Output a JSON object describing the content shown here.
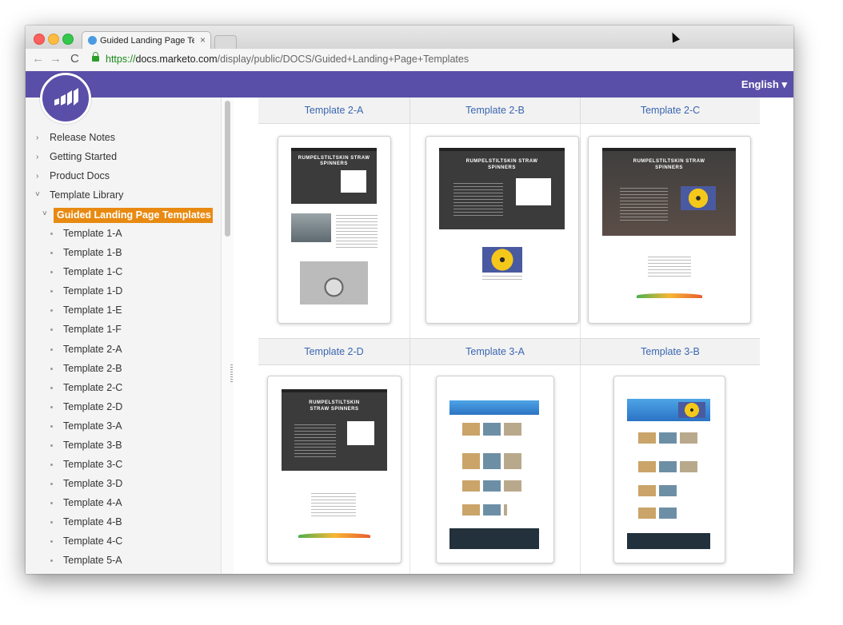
{
  "browser": {
    "tab_title": "Guided Landing Page Temp",
    "tab_close": "×",
    "url_protocol": "https://",
    "url_host": "docs.marketo.com",
    "url_path": "/display/public/DOCS/Guided+Landing+Page+Templates",
    "back_glyph": "←",
    "forward_glyph": "→",
    "reload_glyph": "C"
  },
  "header": {
    "language_label": "English ▾"
  },
  "sidebar": {
    "top_items": [
      {
        "label": "Release Notes"
      },
      {
        "label": "Getting Started"
      },
      {
        "label": "Product Docs"
      },
      {
        "label": "Template Library"
      }
    ],
    "selected_item": "Guided Landing Page Templates",
    "children": [
      "Template 1-A",
      "Template 1-B",
      "Template 1-C",
      "Template 1-D",
      "Template 1-E",
      "Template 1-F",
      "Template 2-A",
      "Template 2-B",
      "Template 2-C",
      "Template 2-D",
      "Template 3-A",
      "Template 3-B",
      "Template 3-C",
      "Template 3-D",
      "Template 4-A",
      "Template 4-B",
      "Template 4-C",
      "Template 5-A"
    ]
  },
  "templates": {
    "row1": [
      "Template 2-A",
      "Template 2-B",
      "Template 2-C"
    ],
    "row2": [
      "Template 2-D",
      "Template 3-A",
      "Template 3-B"
    ],
    "preview_headline_1": "RUMPELSTILTSKIN STRAW",
    "preview_headline_2": "SPINNERS",
    "preview_headline_alt_1": "RUMPELSTILTSKIN",
    "preview_headline_alt_2": "STRAW SPINNERS"
  },
  "colors": {
    "header_purple": "#5a4fa8",
    "selected_orange": "#e88a12",
    "link_blue": "#3a66b0"
  }
}
